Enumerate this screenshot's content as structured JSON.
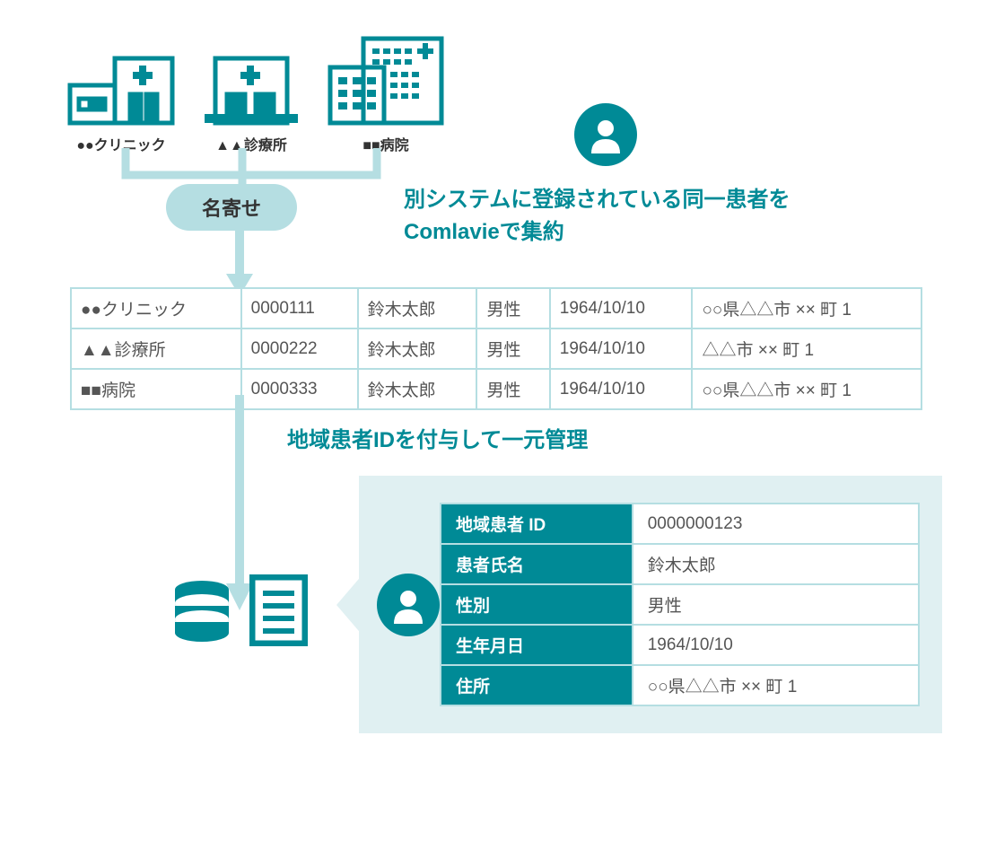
{
  "facilities": [
    {
      "label": "●●クリニック"
    },
    {
      "label": "▲▲診療所"
    },
    {
      "label": "■■病院"
    }
  ],
  "consolidation_label": "名寄せ",
  "headline": "別システムに登録されている同一患者を\nComlavieで集約",
  "source_rows": [
    {
      "facility": "●●クリニック",
      "id": "0000111",
      "name": "鈴木太郎",
      "sex": "男性",
      "dob": "1964/10/10",
      "address": "○○県△△市 ×× 町 1"
    },
    {
      "facility": "▲▲診療所",
      "id": "0000222",
      "name": "鈴木太郎",
      "sex": "男性",
      "dob": "1964/10/10",
      "address": "△△市 ×× 町 1"
    },
    {
      "facility": "■■病院",
      "id": "0000333",
      "name": "鈴木太郎",
      "sex": "男性",
      "dob": "1964/10/10",
      "address": "○○県△△市 ×× 町 1"
    }
  ],
  "caption2": "地域患者IDを付与して一元管理",
  "result_fields": {
    "id_label": "地域患者 ID",
    "id_value": "0000000123",
    "name_label": "患者氏名",
    "name_value": "鈴木太郎",
    "sex_label": "性別",
    "sex_value": "男性",
    "dob_label": "生年月日",
    "dob_value": "1964/10/10",
    "addr_label": "住所",
    "addr_value": "○○県△△市 ×× 町 1"
  }
}
